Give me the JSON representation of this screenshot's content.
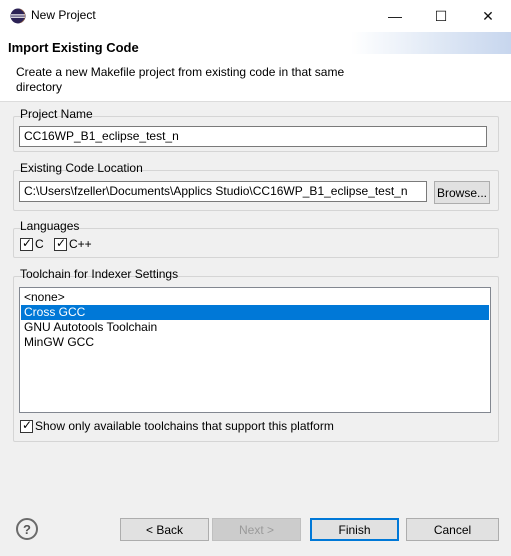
{
  "window": {
    "title": "New Project",
    "minimize_glyph": "—",
    "maximize_glyph": "☐",
    "close_glyph": "✕"
  },
  "header": {
    "title": "Import Existing Code",
    "description": "Create a new Makefile project from existing code in that same directory"
  },
  "project_name": {
    "label": "Project Name",
    "value": "CC16WP_B1_eclipse_test_n"
  },
  "code_location": {
    "label": "Existing Code Location",
    "value": "C:\\Users\\fzeller\\Documents\\Applics Studio\\CC16WP_B1_eclipse_test_n",
    "browse_label": "Browse..."
  },
  "languages": {
    "label": "Languages",
    "items": [
      {
        "label": "C",
        "checked": true
      },
      {
        "label": "C++",
        "checked": true
      }
    ]
  },
  "toolchain": {
    "label": "Toolchain for Indexer Settings",
    "items": [
      "<none>",
      "Cross GCC",
      "GNU Autotools Toolchain",
      "MinGW GCC"
    ],
    "selected": "Cross GCC",
    "show_only_label": "Show only available toolchains that support this platform",
    "show_only_checked": true
  },
  "footer": {
    "help_glyph": "?",
    "back_label": "< Back",
    "next_label": "Next >",
    "finish_label": "Finish",
    "cancel_label": "Cancel"
  },
  "colors": {
    "selection": "#0078d7",
    "default_button_border": "#0078d7",
    "app_icon": "#2c2255"
  },
  "icons": [
    "eclipse-icon",
    "minimize-icon",
    "maximize-icon",
    "close-icon",
    "help-icon",
    "checkmark-icon"
  ]
}
